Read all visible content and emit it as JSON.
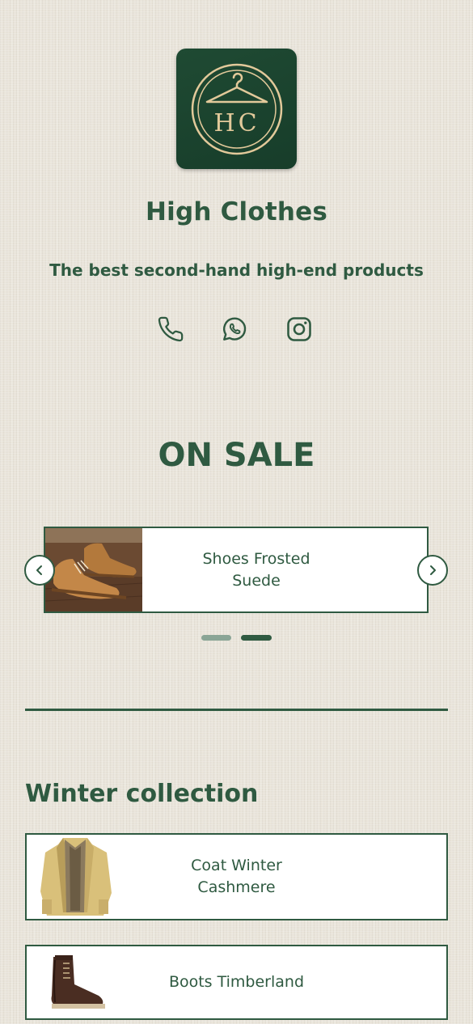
{
  "brand": {
    "logo_text": "HC",
    "name": "High Clothes",
    "tagline": "The best second-hand high-end products"
  },
  "social": [
    {
      "icon": "phone-icon"
    },
    {
      "icon": "whatsapp-icon"
    },
    {
      "icon": "instagram-icon"
    }
  ],
  "sale": {
    "title": "ON SALE",
    "carousel": {
      "current_item": "Shoes Frosted\nSuede",
      "total_slides": 2,
      "active_slide": 2
    }
  },
  "winter": {
    "title": "Winter collection",
    "items": [
      {
        "label": "Coat Winter\nCashmere"
      },
      {
        "label": "Boots Timberland"
      }
    ]
  },
  "colors": {
    "brand_green": "#2f5a41",
    "logo_bg": "#1f4a33",
    "logo_gold": "#e2c99a",
    "background": "#e9e4da"
  }
}
